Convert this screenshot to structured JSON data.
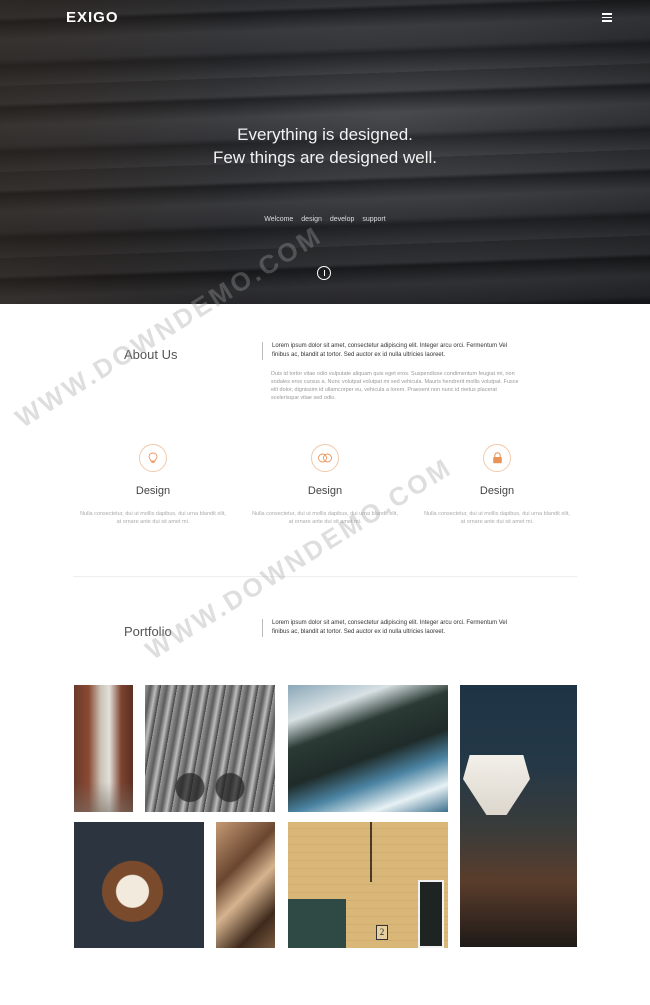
{
  "header": {
    "logo": "EXIGO"
  },
  "hero": {
    "title_line1": "Everything is designed.",
    "title_line2": "Few things are designed well.",
    "nav": [
      "Welcome",
      "design",
      "develop",
      "support"
    ]
  },
  "about": {
    "title": "About Us",
    "intro": "Lorem ipsum dolor sit amet, consectetur adipiscing elit. Integer arcu orci. Fermentum Vel finibus ac, blandit at tortor. Sed auctor ex id nulla ultricies laoreet.",
    "body": "Duis id tortor vitae odio vulputate aliquam quis eget eros. Suspendisse condimentum feugiat mi, non sodales eros cursus a. Nunc volutpat volutpat mi sed vehicula. Mauris hendrerit mollis volutpat. Fusce elit dolor, dignissim id ullamcorper eu, vehicula a lorem. Praesent non nunc id metus placerat scelerisque vitae sed odio."
  },
  "services": [
    {
      "icon": "lightbulb-icon",
      "name": "Design",
      "desc": "Nulla consectetur, dui ut mollis dapibus, dui urna blandit elit, at ornare ante dui sit amet mi."
    },
    {
      "icon": "toggle-icon",
      "name": "Design",
      "desc": "Nulla consectetur, dui ut mollis dapibus, dui urna blandit elit, at ornare ante dui sit amet mi."
    },
    {
      "icon": "lock-icon",
      "name": "Design",
      "desc": "Nulla consectetur, dui ut mollis dapibus, dui urna blandit elit, at ornare ante dui sit amet mi."
    }
  ],
  "portfolio": {
    "title": "Portfolio",
    "intro": "Lorem ipsum dolor sit amet, consectetur adipiscing elit. Integer arcu orci. Fermentum Vel finibus ac, blandit at tortor. Sed auctor ex id nulla ultricies laoreet.",
    "house_number": "2"
  },
  "watermark": {
    "text": "WWW.DOWNDEMO.COM"
  },
  "colors": {
    "accent": "#e8945b",
    "accent_border": "#f0c9ab"
  }
}
